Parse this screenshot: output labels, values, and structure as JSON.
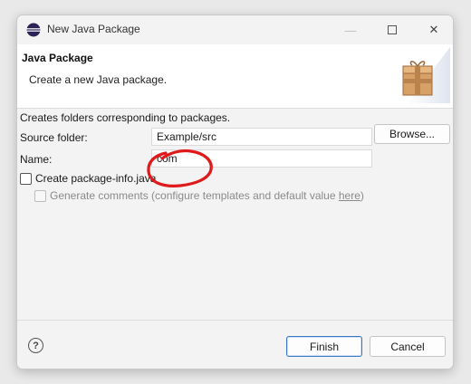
{
  "window": {
    "title": "New Java Package",
    "icon": "eclipse-icon",
    "minimize_glyph": "—",
    "close_glyph": "✕"
  },
  "header": {
    "title": "Java Package",
    "description": "Create a new Java package.",
    "image": "package-icon"
  },
  "form": {
    "info": "Creates folders corresponding to packages.",
    "source_folder_label": "Source folder:",
    "source_folder_value": "Example/src",
    "browse_label": "Browse...",
    "name_label": "Name:",
    "name_value": "com",
    "create_package_info_label": "Create package-info.java",
    "create_package_info_checked": false,
    "generate_comments_prefix": "Generate comments (configure templates and default value ",
    "generate_comments_link": "here",
    "generate_comments_suffix": ")",
    "generate_comments_checked": false,
    "generate_comments_enabled": false
  },
  "footer": {
    "help_glyph": "?",
    "finish_label": "Finish",
    "cancel_label": "Cancel"
  },
  "colors": {
    "annotation": "#e0191b",
    "default_button_border": "#3b78c4"
  }
}
